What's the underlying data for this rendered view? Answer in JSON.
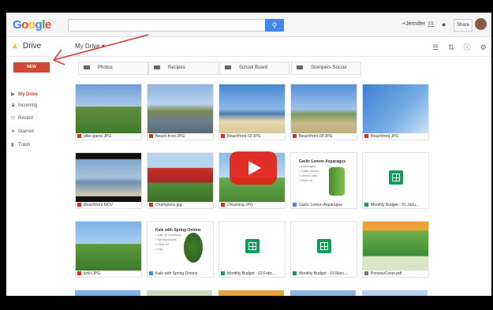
{
  "brand": {
    "logo": "Google",
    "product": "Drive"
  },
  "header": {
    "user": "+Jennifer",
    "share_label": "Share",
    "search_placeholder": ""
  },
  "toolbar": {
    "location": "My Drive ▾"
  },
  "sidebar": {
    "new_label": "NEW",
    "items": [
      {
        "label": "My Drive",
        "icon": "drive-icon"
      },
      {
        "label": "Incoming",
        "icon": "people-icon"
      },
      {
        "label": "Recent",
        "icon": "clock-icon"
      },
      {
        "label": "Starred",
        "icon": "star-icon"
      },
      {
        "label": "Trash",
        "icon": "trash-icon"
      }
    ]
  },
  "folders": [
    "Photos",
    "Recipes",
    "School Board",
    "Stompers Soccer"
  ],
  "files": [
    {
      "name": "after-game.JPG",
      "kind": "image"
    },
    {
      "name": "Beach-front.JPG",
      "kind": "image"
    },
    {
      "name": "Beachfront-02.JPG",
      "kind": "image"
    },
    {
      "name": "Beachfront-03.JPG",
      "kind": "image"
    },
    {
      "name": "Beachfront.JPG",
      "kind": "image"
    },
    {
      "name": "Beachfront.MOV",
      "kind": "video"
    },
    {
      "name": "Champions.jpg",
      "kind": "image"
    },
    {
      "name": "Dreaming.JPG",
      "kind": "image"
    },
    {
      "name": "Garlic Lemon Asparagus",
      "kind": "doc"
    },
    {
      "name": "Monthly Budget - 01 Janu...",
      "kind": "sheet"
    },
    {
      "name": "kick!.JPG",
      "kind": "image"
    },
    {
      "name": "Kale with Spring Onions",
      "kind": "doc"
    },
    {
      "name": "Monthly Budget - 02 Febr...",
      "kind": "sheet"
    },
    {
      "name": "Monthly Budget - 03 Marc...",
      "kind": "sheet"
    },
    {
      "name": "PreviewCover.pdf",
      "kind": "pdf"
    }
  ],
  "docs": {
    "garlic": {
      "title": "Garlic Lemon Asparagus",
      "lines": [
        "• Asparagus",
        "• Garlic cloves",
        "• Lemon zest",
        "• Olive oil"
      ]
    },
    "kale": {
      "title": "Kale with Spring Onions",
      "lines": [
        "• Kale (2 bunches)",
        "• Spring onions",
        "• Olive oil",
        "• Salt"
      ]
    }
  },
  "colors": {
    "new": "#d14836",
    "accent": "#4285f4",
    "sheets": "#0f9d58",
    "play": "#e62117",
    "annotation": "#e53935"
  }
}
